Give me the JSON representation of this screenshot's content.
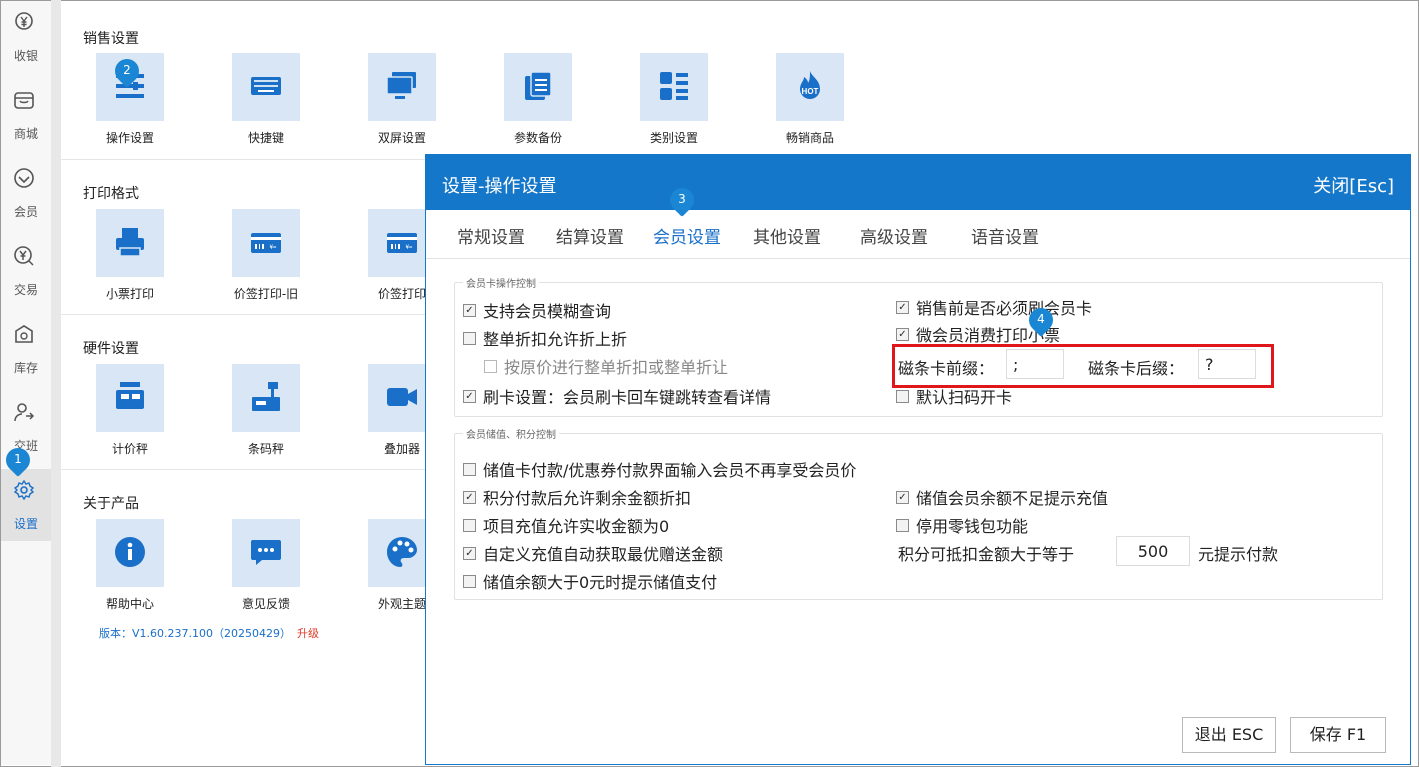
{
  "sidebar": {
    "items": [
      {
        "label": "收银",
        "icon": "yen-coin-icon"
      },
      {
        "label": "商城",
        "icon": "shop-icon"
      },
      {
        "label": "会员",
        "icon": "diamond-icon"
      },
      {
        "label": "交易",
        "icon": "transaction-icon"
      },
      {
        "label": "库存",
        "icon": "inventory-icon"
      },
      {
        "label": "交班",
        "icon": "shift-change-icon"
      },
      {
        "label": "设置",
        "icon": "gear-icon",
        "active": true
      }
    ]
  },
  "sections": {
    "sales": {
      "title": "销售设置",
      "tiles": [
        {
          "label": "操作设置",
          "icon": "operation-settings-icon"
        },
        {
          "label": "快捷键",
          "icon": "keyboard-icon"
        },
        {
          "label": "双屏设置",
          "icon": "dual-screen-icon"
        },
        {
          "label": "参数备份",
          "icon": "backup-icon"
        },
        {
          "label": "类别设置",
          "icon": "category-icon"
        },
        {
          "label": "畅销商品",
          "icon": "hot-icon"
        }
      ]
    },
    "print": {
      "title": "打印格式",
      "tiles": [
        {
          "label": "小票打印",
          "icon": "printer-icon"
        },
        {
          "label": "价签打印-旧",
          "icon": "price-tag-icon"
        },
        {
          "label": "价签打印",
          "icon": "price-tag-icon"
        }
      ]
    },
    "hardware": {
      "title": "硬件设置",
      "tiles": [
        {
          "label": "计价秤",
          "icon": "pricing-scale-icon"
        },
        {
          "label": "条码秤",
          "icon": "barcode-scale-icon"
        },
        {
          "label": "叠加器",
          "icon": "video-overlay-icon"
        }
      ]
    },
    "about": {
      "title": "关于产品",
      "tiles": [
        {
          "label": "帮助中心",
          "icon": "info-icon"
        },
        {
          "label": "意见反馈",
          "icon": "feedback-icon"
        },
        {
          "label": "外观主题",
          "icon": "palette-icon"
        }
      ],
      "version": "版本：V1.60.237.100（20250429）",
      "upgrade": "升级"
    }
  },
  "dialog": {
    "title": "设置-操作设置",
    "close": "关闭[Esc]",
    "tabs": [
      "常规设置",
      "结算设置",
      "会员设置",
      "其他设置",
      "高级设置",
      "语音设置"
    ],
    "active_tab": 2,
    "group1": {
      "title": "会员卡操作控制",
      "options": [
        {
          "label": "支持会员模糊查询",
          "checked": true
        },
        {
          "label": "整单折扣允许折上折",
          "checked": false
        },
        {
          "label": "按原价进行整单折扣或整单折让",
          "checked": false
        },
        {
          "label": "刷卡设置：会员刷卡回车键跳转查看详情",
          "checked": true
        },
        {
          "label": "销售前是否必须刷会员卡",
          "checked": true
        },
        {
          "label": "微会员消费打印小票",
          "checked": true
        },
        {
          "label": "默认扫码开卡",
          "checked": false
        }
      ],
      "prefix_label": "磁条卡前缀：",
      "prefix_value": ";",
      "suffix_label": "磁条卡后缀：",
      "suffix_value": "?"
    },
    "group2": {
      "title": "会员储值、积分控制",
      "options": [
        {
          "label": "储值卡付款/优惠券付款界面输入会员不再享受会员价",
          "checked": false
        },
        {
          "label": "积分付款后允许剩余金额折扣",
          "checked": true
        },
        {
          "label": "项目充值允许实收金额为0",
          "checked": false
        },
        {
          "label": "自定义充值自动获取最优赠送金额",
          "checked": true
        },
        {
          "label": "储值余额大于0元时提示储值支付",
          "checked": false
        },
        {
          "label": "储值会员余额不足提示充值",
          "checked": true
        },
        {
          "label": "停用零钱包功能",
          "checked": false
        }
      ],
      "points_label": "积分可抵扣金额大于等于",
      "points_value": "500",
      "points_suffix": "元提示付款"
    },
    "buttons": {
      "exit": "退出 ESC",
      "save": "保存 F1"
    }
  },
  "markers": [
    "1",
    "2",
    "3",
    "4"
  ],
  "colors": {
    "accent": "#1577c9",
    "tile_bg": "#d8e6f5",
    "icon": "#1a6fc8",
    "highlight": "#e0171a",
    "upgrade": "#e03a2a"
  }
}
